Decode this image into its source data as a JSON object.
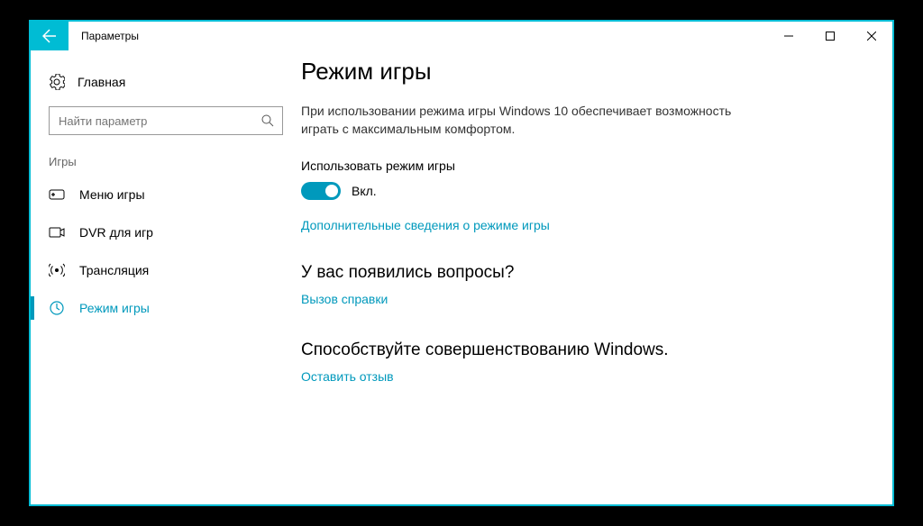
{
  "titlebar": {
    "title": "Параметры"
  },
  "sidebar": {
    "home": "Главная",
    "search_placeholder": "Найти параметр",
    "section": "Игры",
    "items": [
      {
        "label": "Меню игры"
      },
      {
        "label": "DVR для игр"
      },
      {
        "label": "Трансляция"
      },
      {
        "label": "Режим игры"
      }
    ]
  },
  "main": {
    "heading": "Режим игры",
    "description": "При использовании режима игры Windows 10 обеспечивает возможность играть с максимальным комфортом.",
    "toggle_label": "Использовать режим игры",
    "toggle_state": "Вкл.",
    "more_info_link": "Дополнительные сведения о режиме игры",
    "questions_heading": "У вас появились вопросы?",
    "help_link": "Вызов справки",
    "improve_heading": "Способствуйте совершенствованию Windows.",
    "feedback_link": "Оставить отзыв"
  }
}
